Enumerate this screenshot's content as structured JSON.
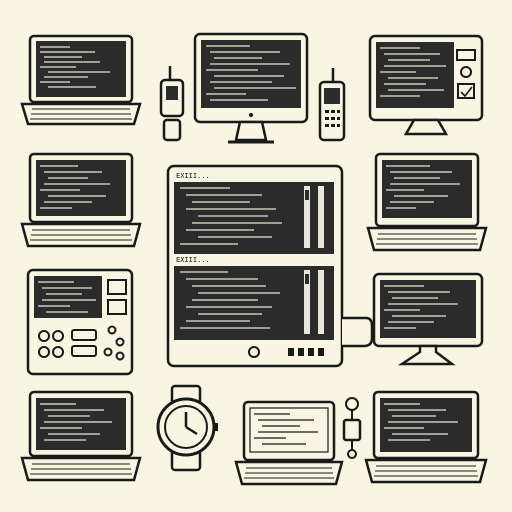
{
  "colors": {
    "background": "#f8f5e3",
    "ink": "#1a1a1a",
    "screen_dark": "#2b2b2b",
    "code_light": "#e8e6d6"
  },
  "icons": [
    "laptop-icon",
    "desktop-monitor-icon",
    "walkie-talkie-icon",
    "cell-phone-icon",
    "control-panel-device-icon",
    "wristwatch-icon",
    "usb-key-icon"
  ],
  "central_monitor": {
    "top_panel_title": "EXIII...",
    "bottom_panel_title": "EXIII..."
  }
}
